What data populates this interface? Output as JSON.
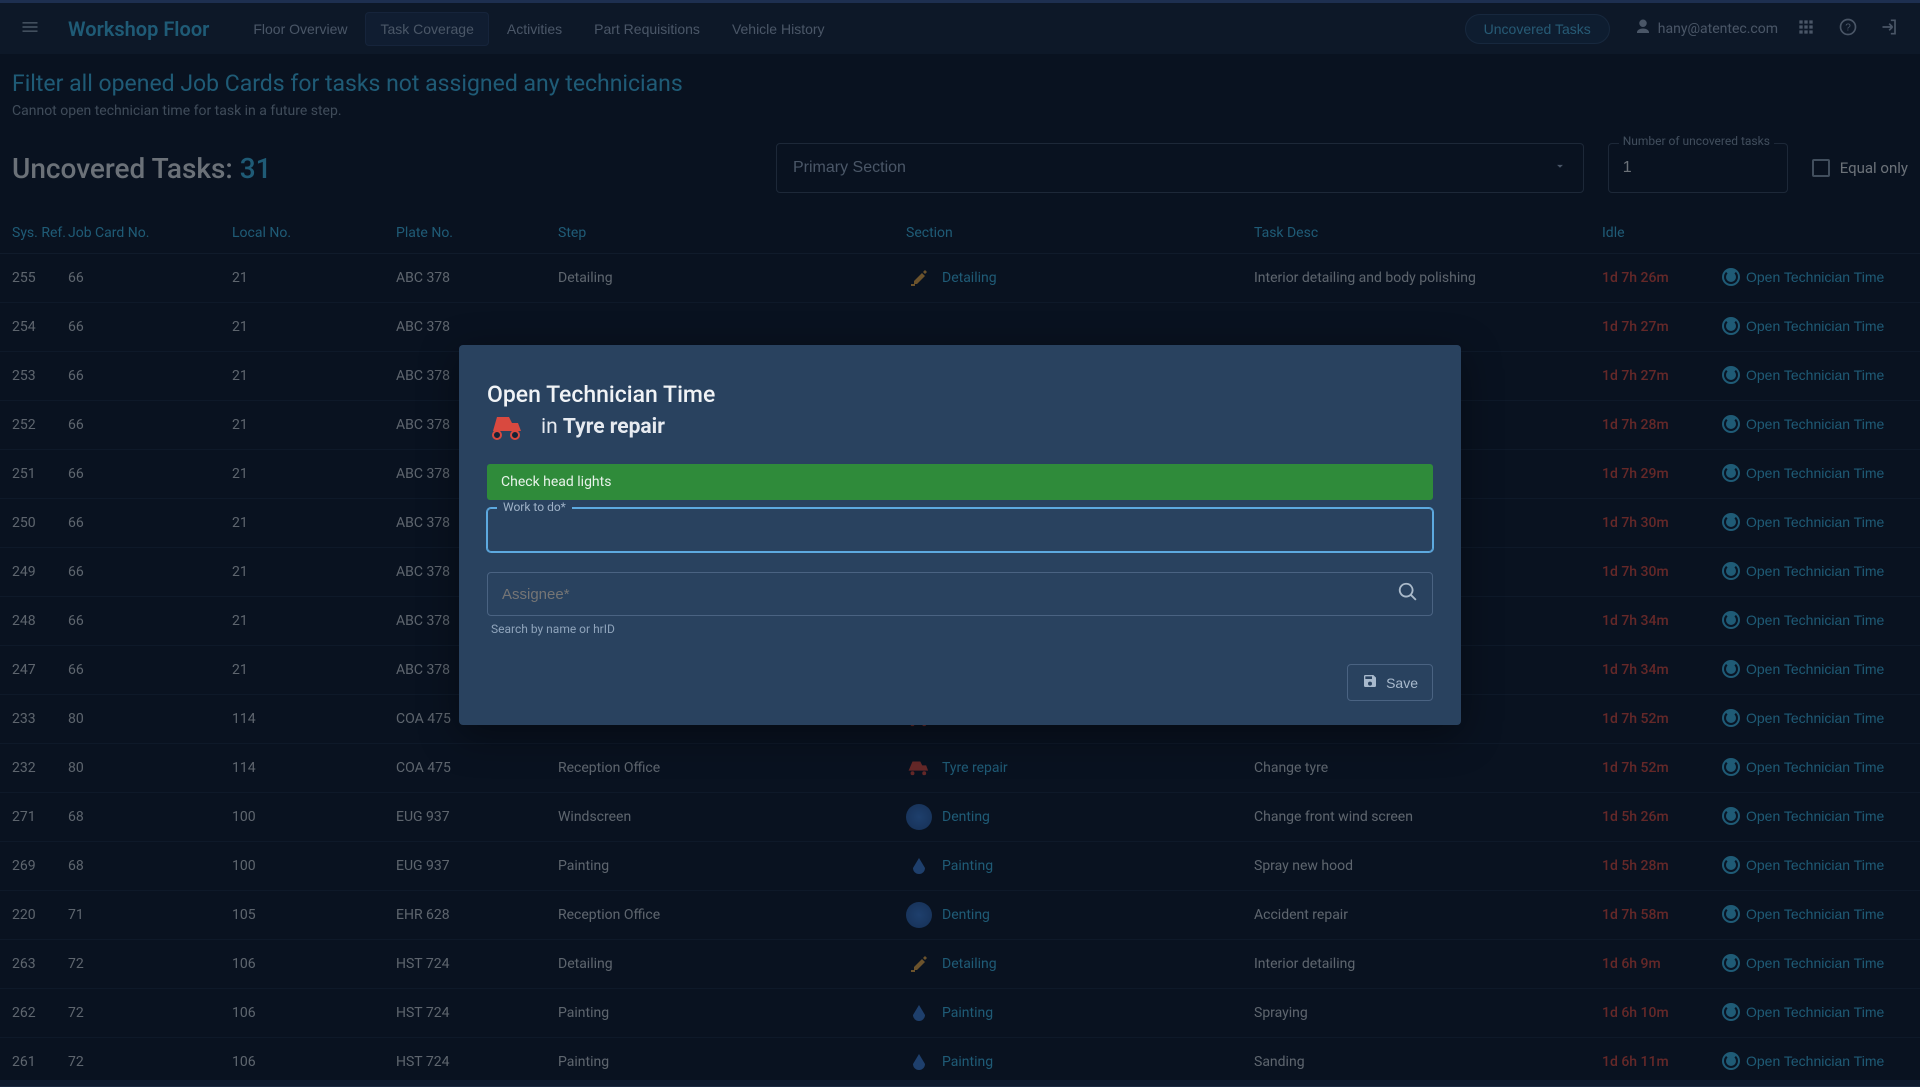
{
  "brand": "Workshop Floor",
  "nav": {
    "tabs": [
      "Floor Overview",
      "Task Coverage",
      "Activities",
      "Part Requisitions",
      "Vehicle History"
    ],
    "activeIndex": 1,
    "uncoveredPill": "Uncovered Tasks"
  },
  "user": {
    "email": "hany@atentec.com"
  },
  "banner": {
    "title": "Filter all opened Job Cards for tasks not assigned any technicians",
    "sub": "Cannot open technician time for task in a future step."
  },
  "countLabel": "Uncovered Tasks: ",
  "countValue": "31",
  "filters": {
    "primarySectionPlaceholder": "Primary Section",
    "numLabel": "Number of uncovered tasks",
    "numValue": "1",
    "equalOnly": "Equal only"
  },
  "columns": {
    "sys": "Sys. Ref.",
    "job": "Job Card No.",
    "local": "Local No.",
    "plate": "Plate No.",
    "step": "Step",
    "section": "Section",
    "desc": "Task Desc",
    "idle": "Idle"
  },
  "actionLabel": "Open Technician Time",
  "rows": [
    {
      "sys": "255",
      "job": "66",
      "local": "21",
      "plate": "ABC 378",
      "step": "Detailing",
      "section": "Detailing",
      "sectKind": "detail",
      "desc": "Interior detailing and body polishing",
      "idle": "1d 7h 26m"
    },
    {
      "sys": "254",
      "job": "66",
      "local": "21",
      "plate": "ABC 378",
      "step": "",
      "section": "",
      "sectKind": "",
      "desc": "",
      "idle": "1d 7h 27m"
    },
    {
      "sys": "253",
      "job": "66",
      "local": "21",
      "plate": "ABC 378",
      "step": "",
      "section": "",
      "sectKind": "",
      "desc": "",
      "idle": "1d 7h 27m"
    },
    {
      "sys": "252",
      "job": "66",
      "local": "21",
      "plate": "ABC 378",
      "step": "",
      "section": "",
      "sectKind": "",
      "desc": "",
      "idle": "1d 7h 28m"
    },
    {
      "sys": "251",
      "job": "66",
      "local": "21",
      "plate": "ABC 378",
      "step": "",
      "section": "",
      "sectKind": "",
      "desc": "",
      "idle": "1d 7h 29m"
    },
    {
      "sys": "250",
      "job": "66",
      "local": "21",
      "plate": "ABC 378",
      "step": "",
      "section": "",
      "sectKind": "",
      "desc": "",
      "idle": "1d 7h 30m"
    },
    {
      "sys": "249",
      "job": "66",
      "local": "21",
      "plate": "ABC 378",
      "step": "",
      "section": "",
      "sectKind": "",
      "desc": "",
      "idle": "1d 7h 30m"
    },
    {
      "sys": "248",
      "job": "66",
      "local": "21",
      "plate": "ABC 378",
      "step": "",
      "section": "",
      "sectKind": "",
      "desc": "",
      "idle": "1d 7h 34m"
    },
    {
      "sys": "247",
      "job": "66",
      "local": "21",
      "plate": "ABC 378",
      "step": "",
      "section": "",
      "sectKind": "",
      "desc": "",
      "idle": "1d 7h 34m"
    },
    {
      "sys": "233",
      "job": "80",
      "local": "114",
      "plate": "COA 475",
      "step": "",
      "section": "",
      "sectKind": "tyre",
      "desc": "",
      "idle": "1d 7h 52m"
    },
    {
      "sys": "232",
      "job": "80",
      "local": "114",
      "plate": "COA 475",
      "step": "Reception Office",
      "section": "Tyre repair",
      "sectKind": "tyre",
      "desc": "Change tyre",
      "idle": "1d 7h 52m"
    },
    {
      "sys": "271",
      "job": "68",
      "local": "100",
      "plate": "EUG 937",
      "step": "Windscreen",
      "section": "Denting",
      "sectKind": "dent",
      "desc": "Change front wind screen",
      "idle": "1d 5h 26m"
    },
    {
      "sys": "269",
      "job": "68",
      "local": "100",
      "plate": "EUG 937",
      "step": "Painting",
      "section": "Painting",
      "sectKind": "paint",
      "desc": "Spray new hood",
      "idle": "1d 5h 28m"
    },
    {
      "sys": "220",
      "job": "71",
      "local": "105",
      "plate": "EHR 628",
      "step": "Reception Office",
      "section": "Denting",
      "sectKind": "dent",
      "desc": "Accident repair",
      "idle": "1d 7h 58m"
    },
    {
      "sys": "263",
      "job": "72",
      "local": "106",
      "plate": "HST 724",
      "step": "Detailing",
      "section": "Detailing",
      "sectKind": "detail",
      "desc": "Interior detailing",
      "idle": "1d 6h 9m"
    },
    {
      "sys": "262",
      "job": "72",
      "local": "106",
      "plate": "HST 724",
      "step": "Painting",
      "section": "Painting",
      "sectKind": "paint",
      "desc": "Spraying",
      "idle": "1d 6h 10m"
    },
    {
      "sys": "261",
      "job": "72",
      "local": "106",
      "plate": "HST 724",
      "step": "Painting",
      "section": "Painting",
      "sectKind": "paint",
      "desc": "Sanding",
      "idle": "1d 6h 11m"
    }
  ],
  "dialog": {
    "title": "Open Technician Time",
    "inPrefix": "in ",
    "section": "Tyre repair",
    "chip": "Check head lights",
    "workLabel": "Work to do*",
    "assigneePlaceholder": "Assignee*",
    "assigneeHint": "Search by name or hrID",
    "saveLabel": "Save"
  }
}
